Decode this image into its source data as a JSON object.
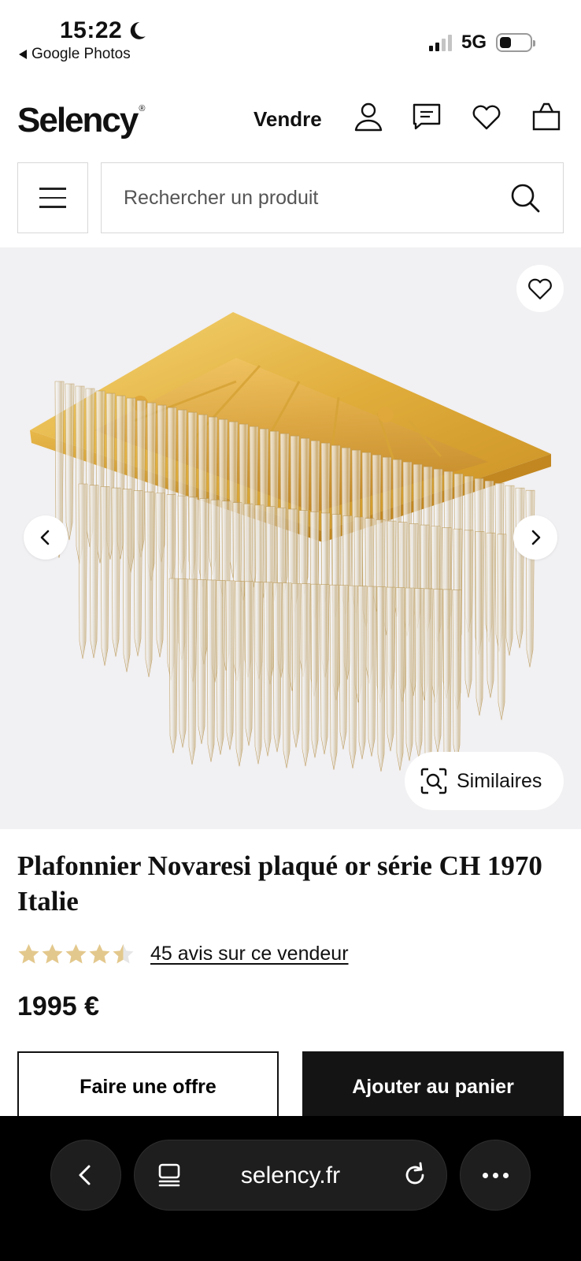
{
  "status_bar": {
    "time": "15:22",
    "back_app": "Google Photos",
    "network": "5G",
    "signal_bars": 2,
    "battery_level": 0.3
  },
  "header": {
    "logo": "Selency",
    "logo_mark": "®",
    "sell_label": "Vendre",
    "icons": [
      "user-icon",
      "message-icon",
      "heart-icon",
      "bag-icon"
    ]
  },
  "search": {
    "placeholder": "Rechercher un produit"
  },
  "gallery": {
    "similar_label": "Similaires",
    "image_description_icon": "chandelier"
  },
  "product": {
    "title": "Plafonnier Novaresi plaqué or série CH 1970 Italie",
    "rating": 4.5,
    "rating_max": 5,
    "reviews_label": "45 avis sur ce vendeur",
    "price": "1995 €",
    "offer_button": "Faire une offre",
    "cart_button": "Ajouter au panier"
  },
  "colors": {
    "star": "#e3c88d",
    "star_empty": "#e6e6e6",
    "gold": "#d9a93a",
    "dark": "#141414"
  },
  "browser": {
    "url": "selency.fr"
  }
}
